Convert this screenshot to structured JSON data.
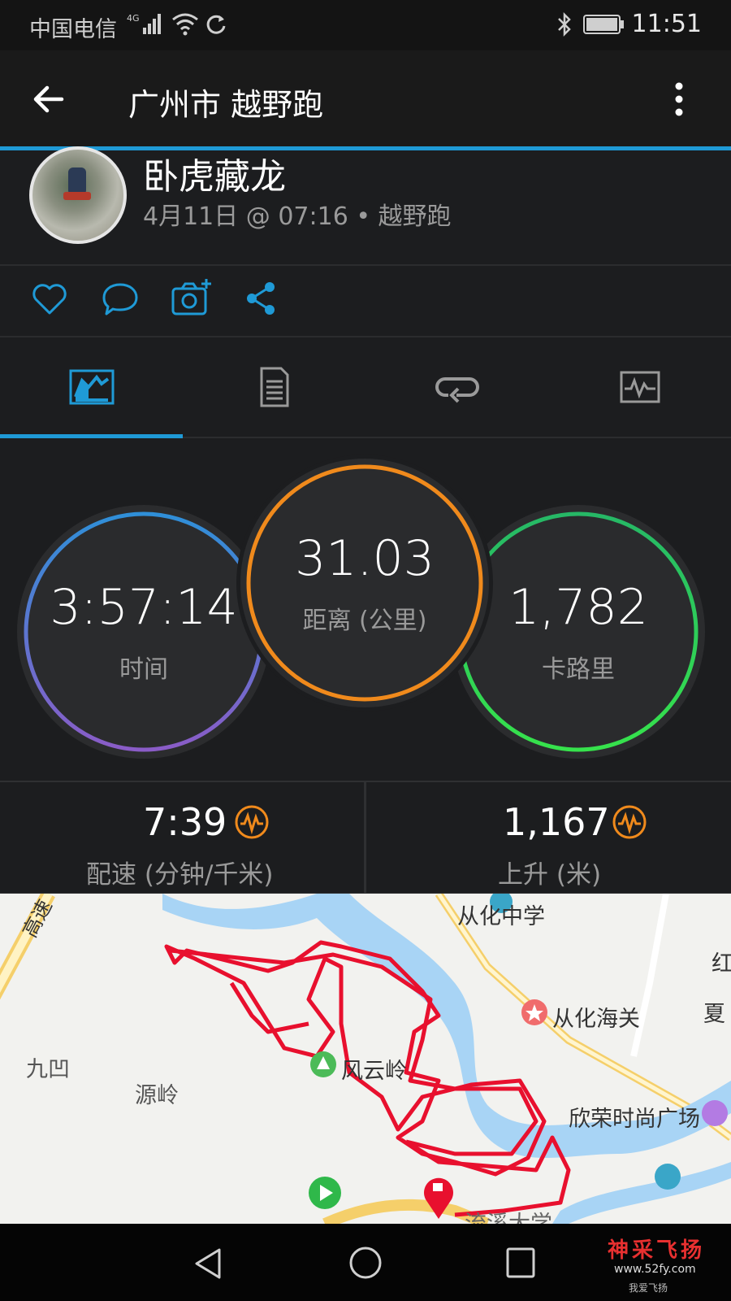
{
  "status_bar": {
    "carrier": "中国电信",
    "time": "11:51"
  },
  "app_bar": {
    "title": "广州市 越野跑"
  },
  "profile": {
    "name": "卧虎藏龙",
    "meta": "4月11日 @ 07:16 • 越野跑"
  },
  "actions": [
    "heart-icon",
    "comment-icon",
    "add-photo-icon",
    "share-icon"
  ],
  "tabs": [
    "stats-tab",
    "details-tab",
    "laps-tab",
    "charts-tab"
  ],
  "stats": {
    "time": {
      "value": "3:57:14",
      "label": "时间"
    },
    "distance": {
      "value": "31.03",
      "label": "距离 (公里)"
    },
    "calories": {
      "value": "1,782",
      "label": "卡路里"
    }
  },
  "sub_stats": {
    "pace": {
      "value": "7:39",
      "label": "配速 (分钟/千米)"
    },
    "ascent": {
      "value": "1,167",
      "label": "上升 (米)"
    }
  },
  "map": {
    "labels": {
      "highway": "高速",
      "school": "从化中学",
      "customs": "从化海关",
      "jiuao": "九凹",
      "yuanling": "源岭",
      "fengyunling": "风云岭",
      "mall": "欣荣时尚广场",
      "edge1": "红",
      "edge2": "夏",
      "edge3": "流溪大学"
    }
  },
  "watermark": {
    "title": "神采飞扬",
    "url": "www.52fy.com",
    "sub": "我爱飞扬"
  },
  "colors": {
    "accent": "#1f9ad6",
    "time_ring_top": "#2f8fd8",
    "time_ring_bottom": "#8a5cc7",
    "distance_ring": "#f08a1c",
    "calories_ring": "#2fd65a",
    "route": "#e8102e"
  }
}
